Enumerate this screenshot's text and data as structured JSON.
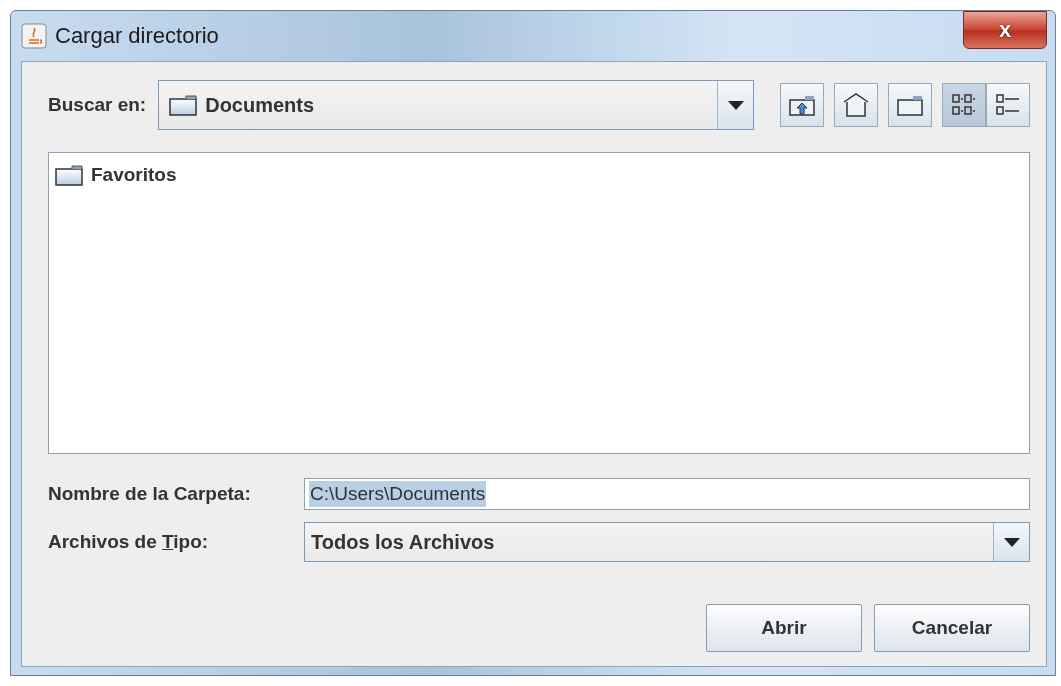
{
  "window": {
    "title": "Cargar directorio",
    "close": "x"
  },
  "look_in": {
    "label": "Buscar en:",
    "value": "Documents"
  },
  "toolbar": [
    {
      "kind": "up",
      "selected": false
    },
    {
      "kind": "home",
      "selected": false
    },
    {
      "kind": "new-folder",
      "selected": false
    },
    {
      "kind": "list",
      "selected": true
    },
    {
      "kind": "details",
      "selected": false
    }
  ],
  "files": [
    {
      "name": "Favoritos",
      "selected": false
    }
  ],
  "folder_name": {
    "label": "Nombre de la Carpeta:",
    "value": "C:\\Users\\Documents",
    "selected": true
  },
  "file_type": {
    "label": {
      "before": "Archivos de ",
      "mnemonic": "T",
      "after": "ipo:"
    },
    "value": "Todos los Archivos"
  },
  "buttons": [
    "Abrir",
    "Cancelar"
  ]
}
